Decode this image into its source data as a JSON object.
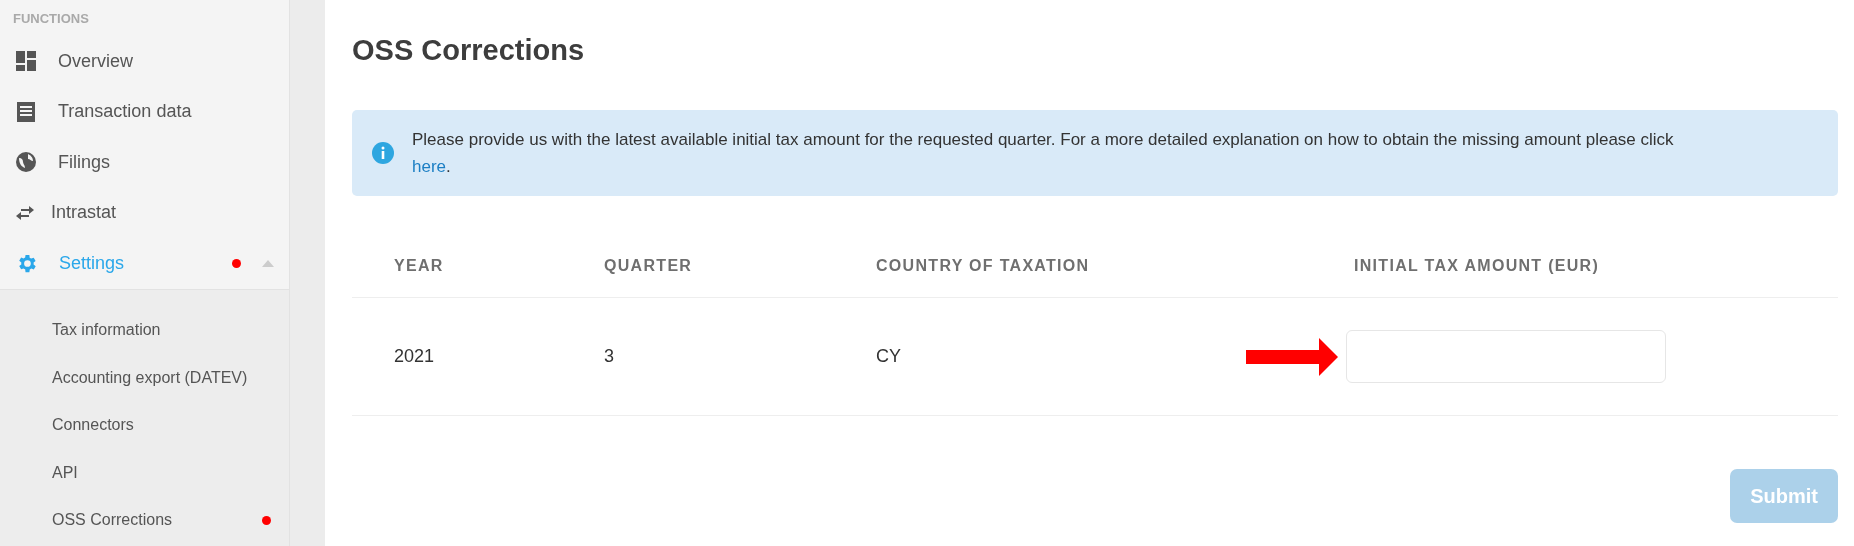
{
  "sidebar": {
    "section_title": "FUNCTIONS",
    "items": [
      {
        "label": "Overview",
        "selected": false,
        "alert": false
      },
      {
        "label": "Transaction data",
        "selected": false,
        "alert": false
      },
      {
        "label": "Filings",
        "selected": false,
        "alert": false
      },
      {
        "label": "Intrastat",
        "selected": false,
        "alert": false
      },
      {
        "label": "Settings",
        "selected": true,
        "alert": true,
        "expanded": true,
        "children": [
          {
            "label": "Tax information",
            "alert": false
          },
          {
            "label": "Accounting export (DATEV)",
            "alert": false
          },
          {
            "label": "Connectors",
            "alert": false
          },
          {
            "label": "API",
            "alert": false
          },
          {
            "label": "OSS Corrections",
            "alert": true
          }
        ]
      }
    ]
  },
  "page_title": "OSS Corrections",
  "info": {
    "text": "Please provide us with the latest available initial tax amount for the requested quarter. For a more detailed explanation on how to obtain the missing amount please click",
    "link": "here",
    "end": "."
  },
  "table": {
    "columns": [
      "YEAR",
      "QUARTER",
      "COUNTRY OF TAXATION",
      "INITIAL TAX AMOUNT (EUR)"
    ],
    "rows": [
      {
        "year": "2021",
        "quarter": "3",
        "country": "CY",
        "highlighted": true
      }
    ]
  },
  "submit": {
    "label": "Submit",
    "disabled": true
  }
}
